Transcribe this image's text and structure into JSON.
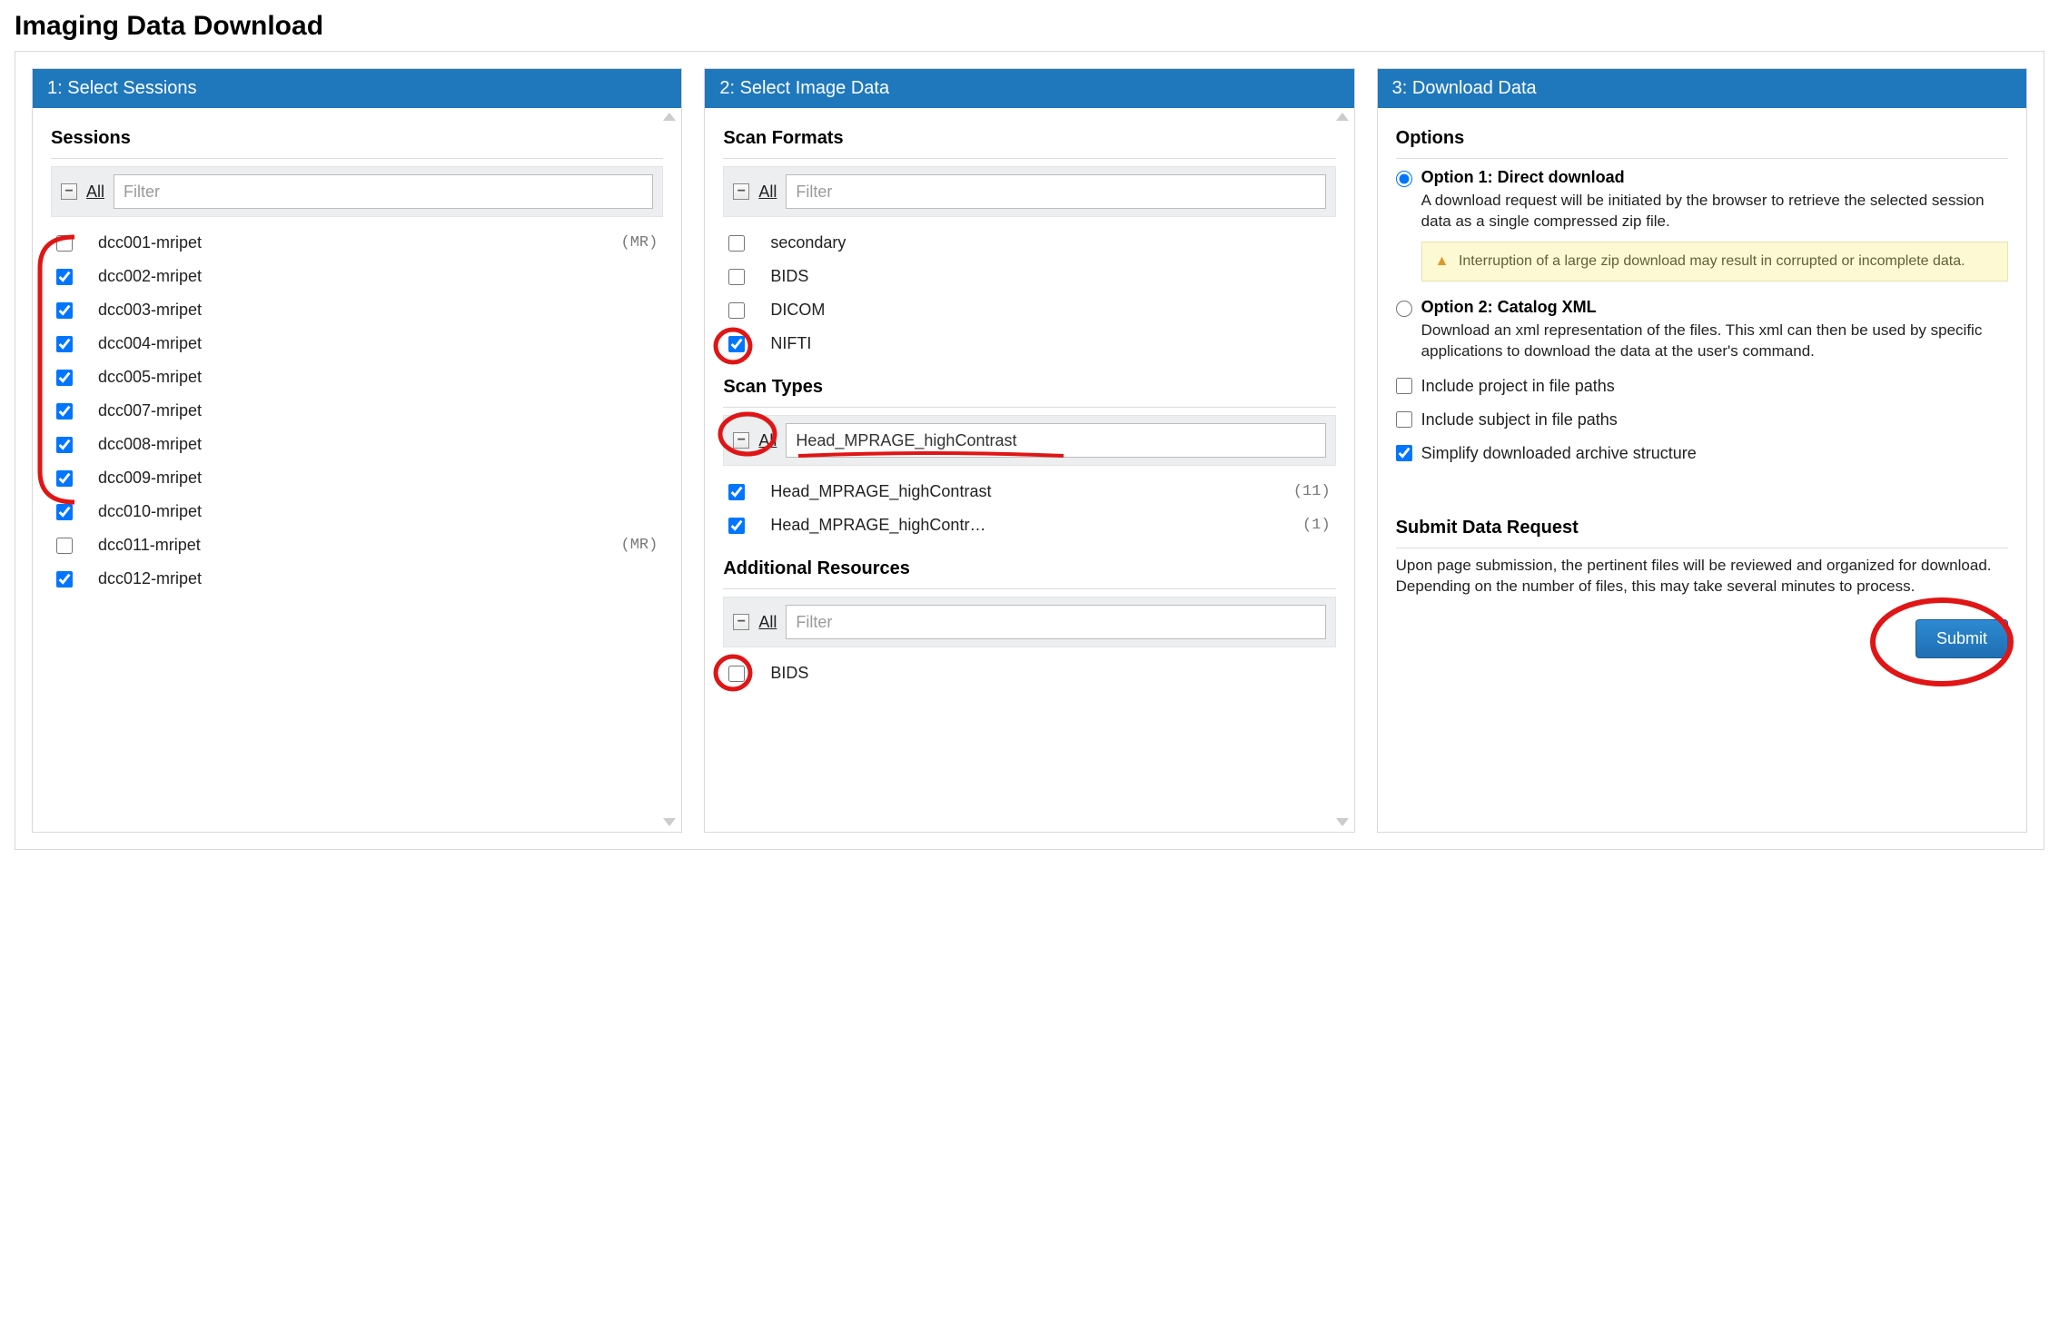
{
  "page_title": "Imaging Data Download",
  "panel1": {
    "header": "1: Select Sessions",
    "section_title": "Sessions",
    "all_label": "All",
    "filter_placeholder": "Filter",
    "items": [
      {
        "label": "dcc001-mripet",
        "checked": false,
        "tag": "(MR)"
      },
      {
        "label": "dcc002-mripet",
        "checked": true,
        "tag": ""
      },
      {
        "label": "dcc003-mripet",
        "checked": true,
        "tag": ""
      },
      {
        "label": "dcc004-mripet",
        "checked": true,
        "tag": ""
      },
      {
        "label": "dcc005-mripet",
        "checked": true,
        "tag": ""
      },
      {
        "label": "dcc007-mripet",
        "checked": true,
        "tag": ""
      },
      {
        "label": "dcc008-mripet",
        "checked": true,
        "tag": ""
      },
      {
        "label": "dcc009-mripet",
        "checked": true,
        "tag": ""
      },
      {
        "label": "dcc010-mripet",
        "checked": true,
        "tag": ""
      },
      {
        "label": "dcc011-mripet",
        "checked": false,
        "tag": "(MR)"
      },
      {
        "label": "dcc012-mripet",
        "checked": true,
        "tag": ""
      }
    ]
  },
  "panel2": {
    "header": "2: Select Image Data",
    "scan_formats": {
      "title": "Scan Formats",
      "all_label": "All",
      "filter_placeholder": "Filter",
      "items": [
        {
          "label": "secondary",
          "checked": false
        },
        {
          "label": "BIDS",
          "checked": false
        },
        {
          "label": "DICOM",
          "checked": false
        },
        {
          "label": "NIFTI",
          "checked": true
        }
      ]
    },
    "scan_types": {
      "title": "Scan Types",
      "all_label": "All",
      "filter_value": "Head_MPRAGE_highContrast",
      "items": [
        {
          "label": "Head_MPRAGE_highContrast",
          "checked": true,
          "count": "(11)"
        },
        {
          "label": "Head_MPRAGE_highContr…",
          "checked": true,
          "count": "(1)"
        }
      ]
    },
    "additional": {
      "title": "Additional Resources",
      "all_label": "All",
      "filter_placeholder": "Filter",
      "items": [
        {
          "label": "BIDS",
          "checked": false
        }
      ]
    }
  },
  "panel3": {
    "header": "3: Download Data",
    "options_title": "Options",
    "option1_title": "Option 1: Direct download",
    "option1_desc": "A download request will be initiated by the browser to retrieve the selected session data as a single compressed zip file.",
    "warning": "Interruption of a large zip download may result in corrupted or incomplete data.",
    "option2_title": "Option 2: Catalog XML",
    "option2_desc": "Download an xml representation of the files. This xml can then be used by specific applications to download the data at the user's command.",
    "include_project": "Include project in file paths",
    "include_subject": "Include subject in file paths",
    "simplify": "Simplify downloaded archive structure",
    "submit_title": "Submit Data Request",
    "submit_desc": "Upon page submission, the pertinent files will be reviewed and organized for download. Depending on the number of files, this may take several minutes to process.",
    "submit_button": "Submit"
  }
}
